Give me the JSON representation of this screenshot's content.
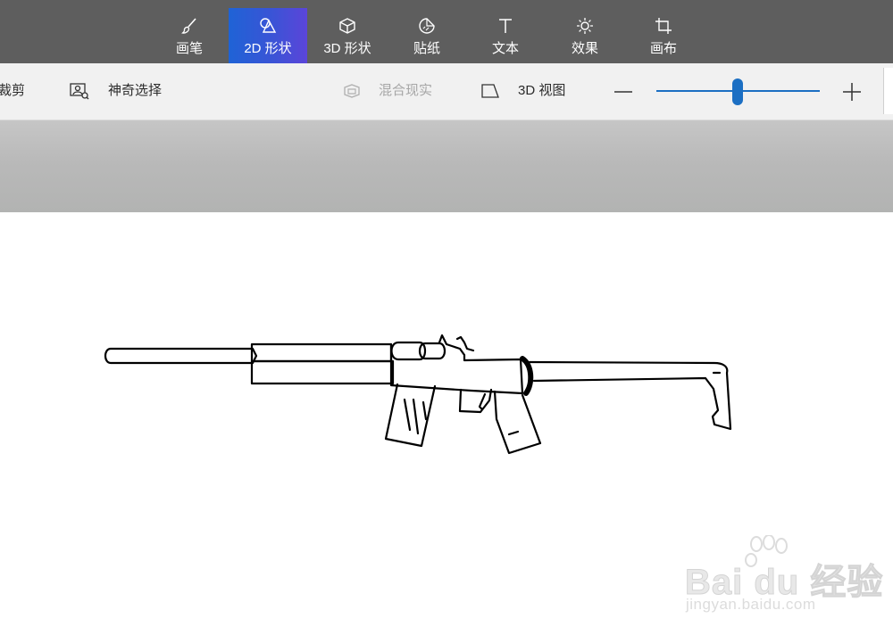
{
  "toolbar": {
    "tools": [
      {
        "label": "画笔",
        "icon": "brush-icon"
      },
      {
        "label": "2D 形状",
        "icon": "shapes-2d-icon",
        "active": true
      },
      {
        "label": "3D 形状",
        "icon": "cube-icon"
      },
      {
        "label": "贴纸",
        "icon": "sticker-icon"
      },
      {
        "label": "文本",
        "icon": "text-icon"
      },
      {
        "label": "效果",
        "icon": "sun-icon"
      },
      {
        "label": "画布",
        "icon": "canvas-crop-icon"
      }
    ]
  },
  "subbar": {
    "crop_label": "裁剪",
    "magic_select_label": "神奇选择",
    "mixed_reality_label": "混合现实",
    "view_3d_label": "3D 视图",
    "zoom_level": 0.5
  },
  "colors": {
    "toolbar_bg": "#5e5e5e",
    "active_tab_gradient": [
      "#1f63d6",
      "#5b45d9"
    ],
    "accent": "#1c6fc3",
    "subbar_bg": "#f1f1f1",
    "workspace_bg": "#b9b9b9"
  },
  "watermark": {
    "brand": "Bai du 经验",
    "url": "jingyan.baidu.com"
  }
}
